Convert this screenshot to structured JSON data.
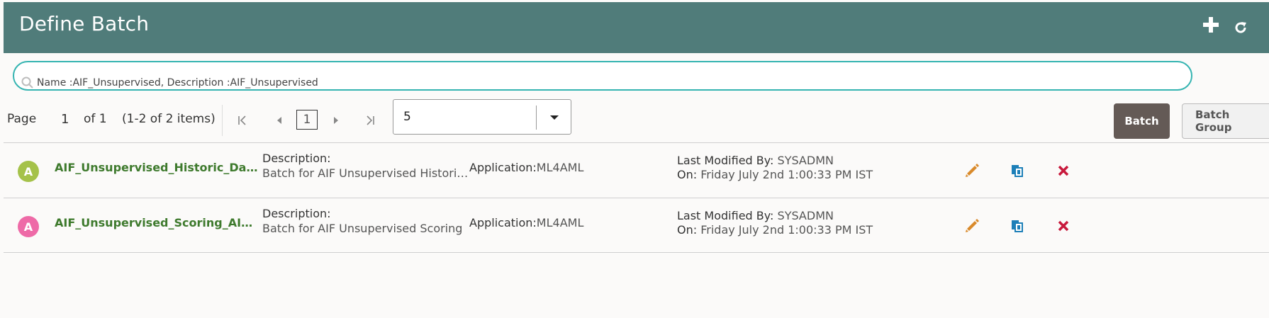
{
  "header": {
    "title": "Define Batch",
    "add_icon": "plus-icon",
    "refresh_icon": "refresh-icon",
    "bg_color": "#507c7a"
  },
  "search": {
    "value": "Name :AIF_Unsupervised, Description :AIF_Unsupervised",
    "icon": "search-icon",
    "border_color": "#35b4b1"
  },
  "pager": {
    "page_label": "Page",
    "current_page": "1",
    "of_label": "of 1",
    "items_label": "(1-2 of 2 items)",
    "page_box": "1",
    "page_size": "5"
  },
  "buttons": {
    "batch": "Batch",
    "batch_group": "Batch Group"
  },
  "rows": [
    {
      "avatar": "A",
      "avatar_color": "#a5c24a",
      "name": "AIF_Unsupervised_Historic_Data_Load_AIFSANDBOX",
      "desc_label": "Description:",
      "desc": "Batch for AIF Unsupervised Historic Data Load",
      "app_label": "Application:",
      "app": "ML4AML",
      "mod_by_label": "Last Modified By:",
      "mod_by": "SYSADMN",
      "on_label": "On:",
      "on": "Friday July 2nd 1:00:33 PM IST"
    },
    {
      "avatar": "A",
      "avatar_color": "#ee6aa7",
      "name": "AIF_Unsupervised_Scoring_AIFSANDBOX",
      "desc_label": "Description:",
      "desc": "Batch for AIF Unsupervised Scoring",
      "app_label": "Application:",
      "app": "ML4AML",
      "mod_by_label": "Last Modified By:",
      "mod_by": "SYSADMN",
      "on_label": "On:",
      "on": "Friday July 2nd 1:00:33 PM IST"
    }
  ],
  "action_colors": {
    "edit": "#d98a2b",
    "copy": "#1d7fb8",
    "delete": "#c8193c"
  }
}
